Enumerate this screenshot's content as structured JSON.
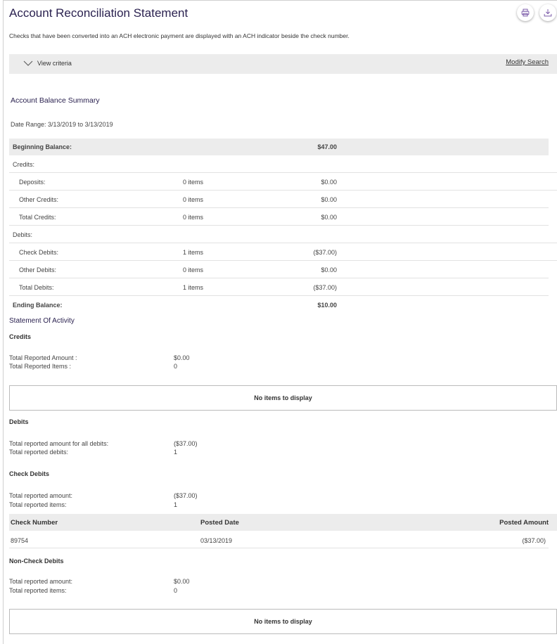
{
  "header": {
    "title": "Account Reconciliation Statement",
    "print_icon": "printer-icon",
    "download_icon": "download-icon"
  },
  "intro_text": "Checks that have been converted into an ACH electronic payment are displayed with an ACH indicator beside the check number.",
  "criteria": {
    "toggle_label": "View criteria",
    "toggle_icon": "chevron-down-icon",
    "modify_label": "Modify Search"
  },
  "summary": {
    "title": "Account Balance Summary",
    "date_range": "Date Range: 3/13/2019 to 3/13/2019",
    "beginning": {
      "label": "Beginning Balance:",
      "amount": "$47.00"
    },
    "credits_label": "Credits:",
    "deposits": {
      "label": "Deposits:",
      "items": "0 items",
      "amount": "$0.00"
    },
    "other_credits": {
      "label": "Other Credits:",
      "items": "0 items",
      "amount": "$0.00"
    },
    "total_credits": {
      "label": "Total Credits:",
      "items": "0 items",
      "amount": "$0.00"
    },
    "debits_label": "Debits:",
    "check_debits": {
      "label": "Check Debits:",
      "items": "1 items",
      "amount": "($37.00)"
    },
    "other_debits": {
      "label": "Other Debits:",
      "items": "0 items",
      "amount": "$0.00"
    },
    "total_debits": {
      "label": "Total Debits:",
      "items": "1 items",
      "amount": "($37.00)"
    },
    "ending": {
      "label": "Ending Balance:",
      "amount": "$10.00"
    }
  },
  "activity": {
    "title": "Statement Of Activity",
    "credits": {
      "heading": "Credits",
      "amount_label": "Total Reported Amount :",
      "amount_value": "$0.00",
      "items_label": "Total Reported Items :",
      "items_value": "0",
      "empty_text": "No items to display"
    },
    "debits": {
      "heading": "Debits",
      "amount_label": "Total reported amount for all debits:",
      "amount_value": "($37.00)",
      "items_label": "Total reported debits:",
      "items_value": "1"
    },
    "check_debits": {
      "heading": "Check Debits",
      "amount_label": "Total reported amount:",
      "amount_value": "($37.00)",
      "items_label": "Total reported items:",
      "items_value": "1",
      "columns": [
        "Check Number",
        "Posted Date",
        "Posted Amount"
      ],
      "rows": [
        {
          "check_number": "89754",
          "posted_date": "03/13/2019",
          "posted_amount": "($37.00)"
        }
      ]
    },
    "non_check_debits": {
      "heading": "Non-Check Debits",
      "amount_label": "Total reported amount:",
      "amount_value": "$0.00",
      "items_label": "Total reported items:",
      "items_value": "0",
      "empty_text": "No items to display"
    }
  }
}
